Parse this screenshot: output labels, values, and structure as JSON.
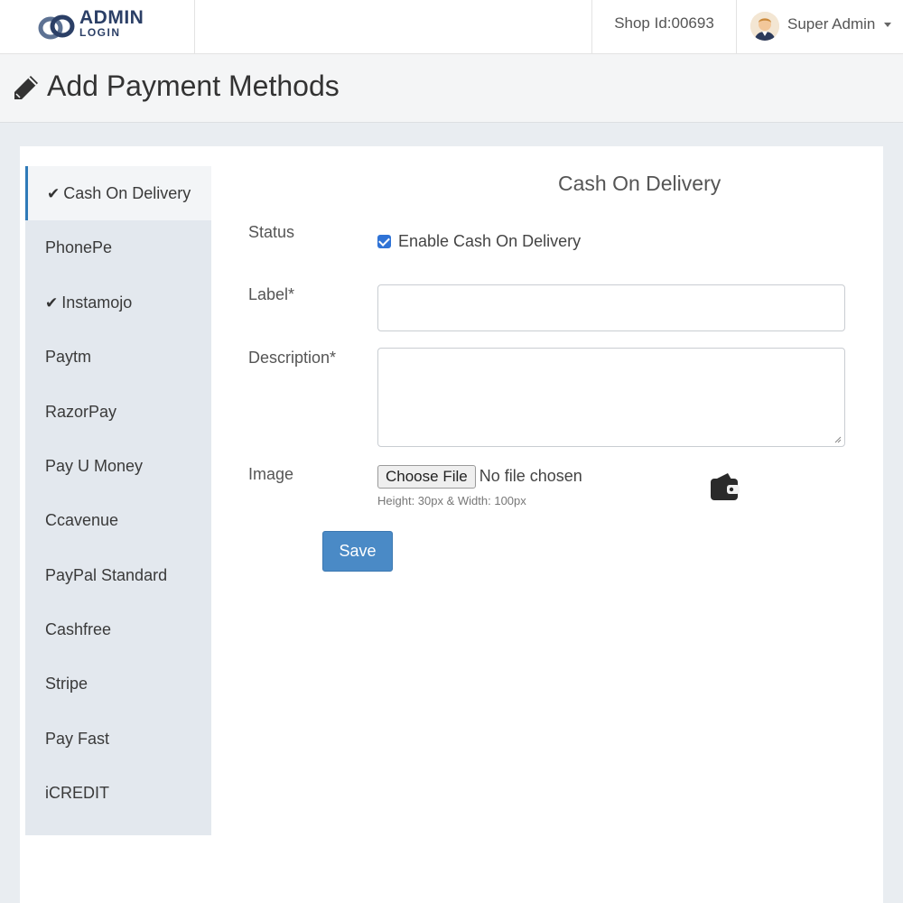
{
  "header": {
    "brand_main": "ADMIN",
    "brand_sub": "LOGIN",
    "shop_id": "Shop Id:00693",
    "user_name": "Super Admin"
  },
  "page": {
    "title": "Add Payment Methods"
  },
  "sidebar": {
    "items": [
      {
        "label": "Cash On Delivery",
        "checked": true,
        "active": true
      },
      {
        "label": "PhonePe",
        "checked": false
      },
      {
        "label": "Instamojo",
        "checked": true
      },
      {
        "label": "Paytm",
        "checked": false
      },
      {
        "label": "RazorPay",
        "checked": false
      },
      {
        "label": "Pay U Money",
        "checked": false
      },
      {
        "label": "Ccavenue",
        "checked": false
      },
      {
        "label": "PayPal Standard",
        "checked": false
      },
      {
        "label": "Cashfree",
        "checked": false
      },
      {
        "label": "Stripe",
        "checked": false
      },
      {
        "label": "Pay Fast",
        "checked": false
      },
      {
        "label": "iCREDIT",
        "checked": false
      }
    ],
    "check_glyph": "✔"
  },
  "form": {
    "title": "Cash On Delivery",
    "status_label": "Status",
    "enable_label": "Enable Cash On Delivery",
    "enable_checked": true,
    "label_label": "Label*",
    "label_value": "",
    "description_label": "Description*",
    "description_value": "",
    "image_label": "Image",
    "choose_file": "Choose File",
    "no_file": "No file chosen",
    "image_hint": "Height: 30px & Width: 100px",
    "save": "Save"
  },
  "colors": {
    "brand": "#2b3f66",
    "primary_button": "#4a8ac6",
    "active_border": "#2f7ab8",
    "checkbox": "#2f73d6"
  },
  "icons": [
    "logo-mark-icon",
    "pencil-icon",
    "checkmark-icon",
    "wallet-icon",
    "caret-down-icon",
    "user-avatar-icon"
  ]
}
